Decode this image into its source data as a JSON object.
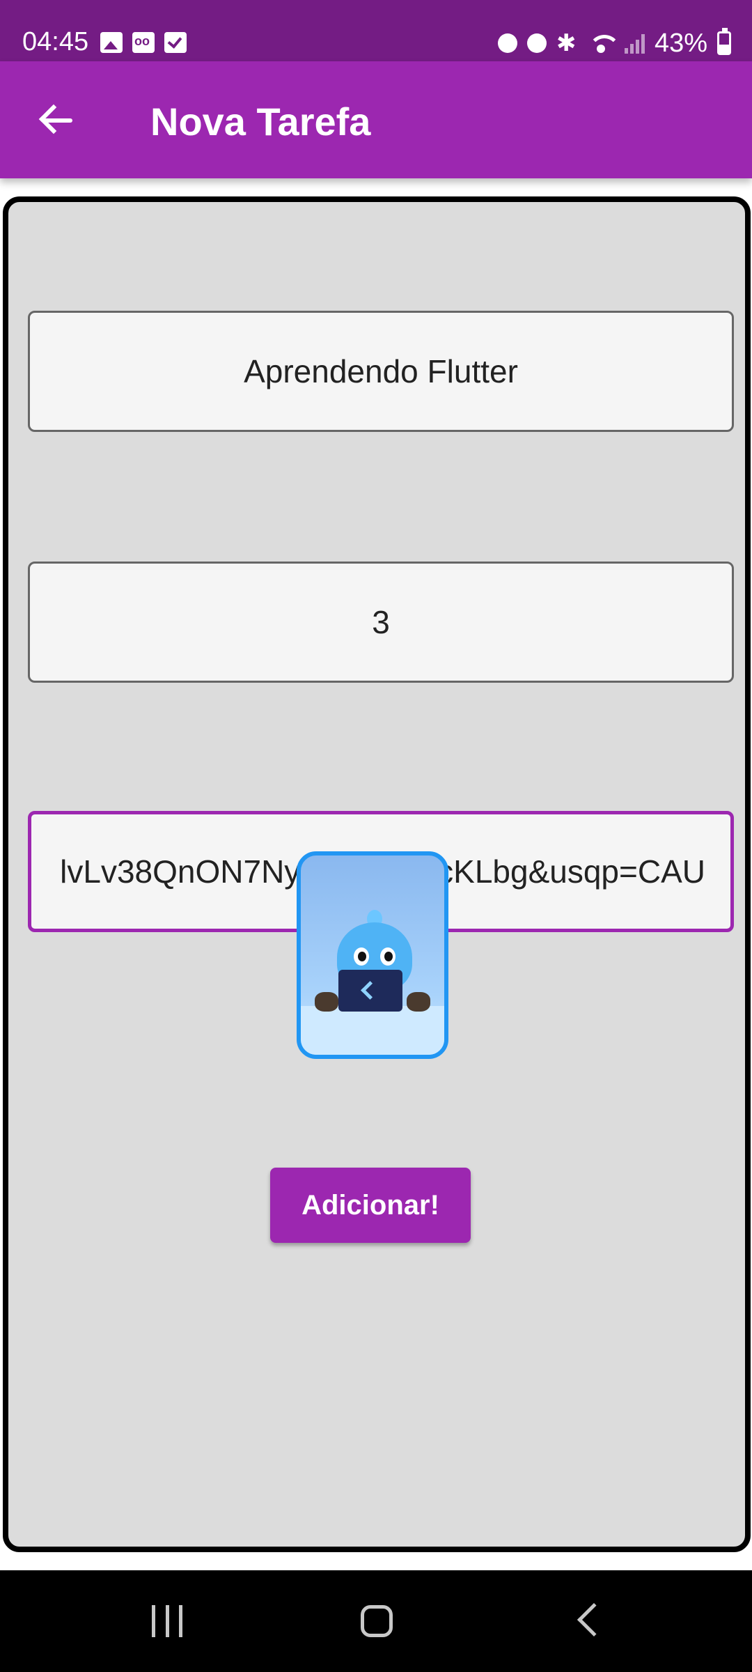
{
  "status_bar": {
    "time": "04:45",
    "battery": "43%",
    "battery_level": 0.43,
    "left_icons": [
      "image-icon",
      "voicemail-icon",
      "checkbox-icon"
    ],
    "right_icons": [
      "lock-notification-icon",
      "alarm-icon",
      "bluetooth-icon",
      "wifi-icon",
      "signal-icon",
      "battery-icon"
    ]
  },
  "app_bar": {
    "back_icon": "arrow-left-icon",
    "title": "Nova Tarefa",
    "color": "#9c27b0"
  },
  "form": {
    "name_field": {
      "value": "Aprendendo Flutter"
    },
    "difficulty_field": {
      "value": "3"
    },
    "image_url_field": {
      "value": "lvLv38QnON7Nyv3F4CdQcKLbg&usqp=CAU",
      "focused": true
    },
    "preview_image": "flutter-dash-mascot-image",
    "submit_label": "Adicionar!"
  },
  "nav_bar": {
    "icons": [
      "recents-icon",
      "home-icon",
      "back-icon"
    ]
  }
}
